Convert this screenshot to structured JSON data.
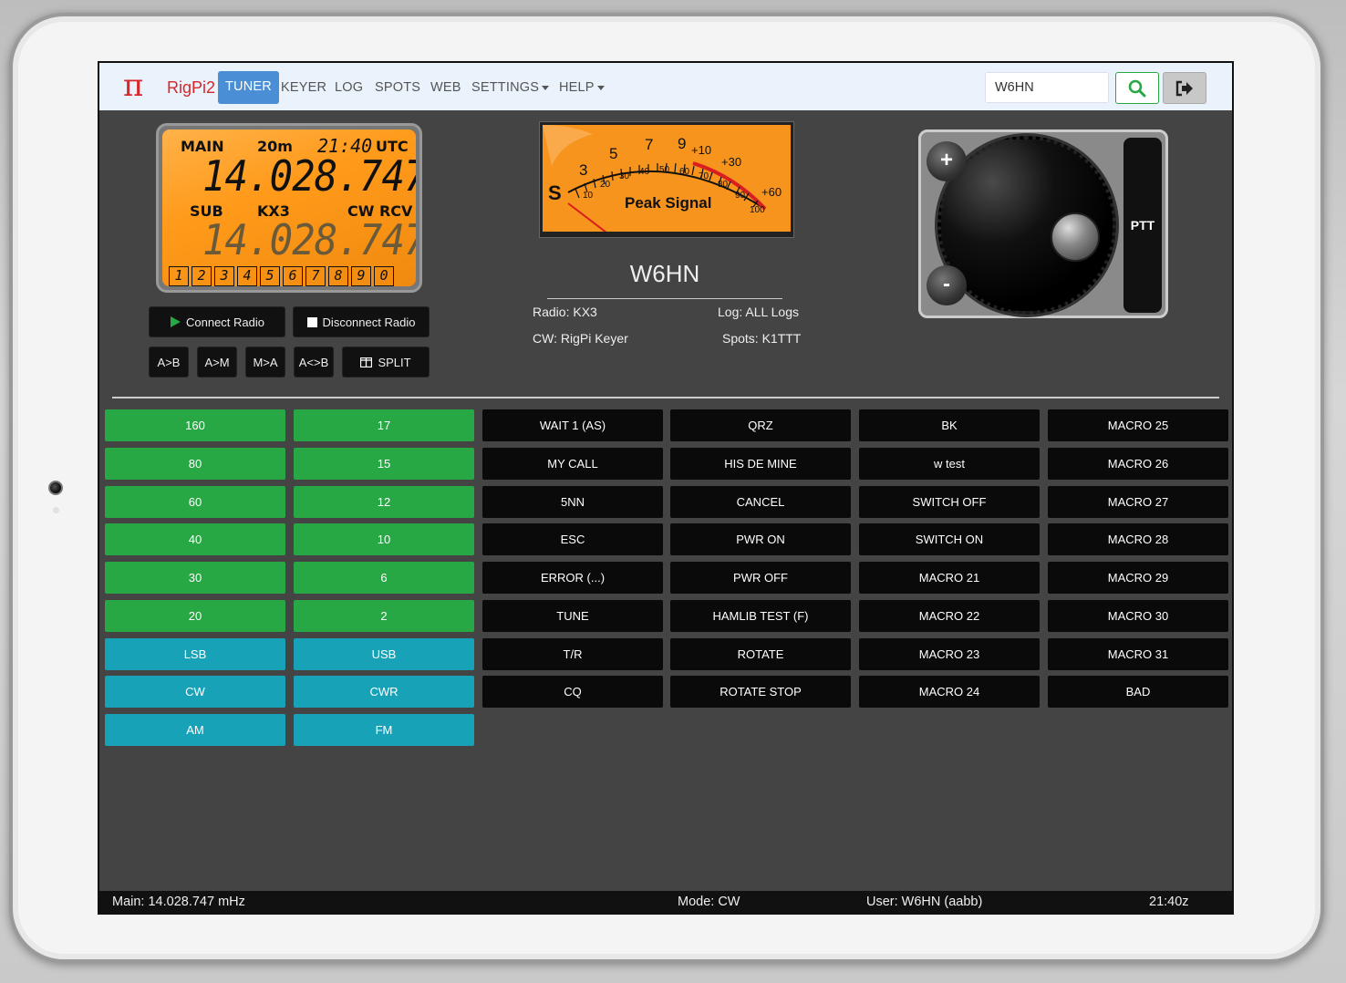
{
  "navbar": {
    "logo_glyph": "π",
    "brand": "RigPi2",
    "items": [
      "TUNER",
      "KEYER",
      "LOG",
      "SPOTS",
      "WEB",
      "SETTINGS",
      "HELP"
    ],
    "active_item": "TUNER",
    "search_value": "W6HN",
    "search_icon": "search-icon",
    "logout_icon": "logout-icon"
  },
  "lcd": {
    "main_label": "MAIN",
    "band": "20m",
    "time": "21:40",
    "utc": "UTC",
    "main_freq": "14.028.747",
    "sub_label": "SUB",
    "radio": "KX3",
    "mode_label": "CW RCV",
    "sub_freq": "14.028.747",
    "memory_digits": [
      "1",
      "2",
      "3",
      "4",
      "5",
      "6",
      "7",
      "8",
      "9",
      "0"
    ],
    "background_color": "#ff9a1a"
  },
  "radio_controls": {
    "connect": "Connect Radio",
    "disconnect": "Disconnect Radio",
    "a_to_b": "A>B",
    "a_to_m": "A>M",
    "m_to_a": "M>A",
    "a_swap_b": "A<>B",
    "split": "SPLIT"
  },
  "meter": {
    "title": "Peak Signal",
    "s_label": "S",
    "scale_top": [
      "3",
      "5",
      "7",
      "9",
      "+10",
      "+30",
      "+60"
    ],
    "scale_bottom": [
      "10",
      "20",
      "30",
      "40",
      "50",
      "60",
      "70",
      "80",
      "90",
      "100"
    ]
  },
  "station": {
    "callsign": "W6HN",
    "radio": "Radio: KX3",
    "log": "Log: ALL Logs",
    "cw": "CW: RigPi Keyer",
    "spots": "Spots: K1TTT"
  },
  "knob": {
    "plus": "+",
    "minus": "-",
    "ptt": "PTT"
  },
  "bands_col1": [
    "160",
    "80",
    "60",
    "40",
    "30",
    "20"
  ],
  "bands_col2": [
    "17",
    "15",
    "12",
    "10",
    "6",
    "2"
  ],
  "modes_col1": [
    "LSB",
    "CW",
    "AM"
  ],
  "modes_col2": [
    "USB",
    "CWR",
    "FM"
  ],
  "macros": {
    "col1": [
      "WAIT 1 (AS)",
      "MY CALL",
      "5NN",
      "ESC",
      "ERROR (...)",
      "TUNE",
      "T/R",
      "CQ"
    ],
    "col2": [
      "QRZ",
      "HIS DE MINE",
      "CANCEL",
      "PWR ON",
      "PWR OFF",
      "HAMLIB TEST (F)",
      "ROTATE",
      "ROTATE STOP"
    ],
    "col3": [
      "BK",
      "w test",
      "SWITCH OFF",
      "SWITCH ON",
      "MACRO 21",
      "MACRO 22",
      "MACRO 23",
      "MACRO 24"
    ],
    "col4": [
      "MACRO 25",
      "MACRO 26",
      "MACRO 27",
      "MACRO 28",
      "MACRO 29",
      "MACRO 30",
      "MACRO 31",
      "BAD"
    ]
  },
  "status": {
    "main": "Main: 14.028.747 mHz",
    "mode": "Mode: CW",
    "user": "User: W6HN (aabb)",
    "time": "21:40z"
  },
  "colors": {
    "band_green": "#28a745",
    "mode_blue": "#17a2b8",
    "macro_black": "#0a0a0a",
    "brand_red": "#d8262a",
    "nav_active": "#4a8fd6"
  }
}
